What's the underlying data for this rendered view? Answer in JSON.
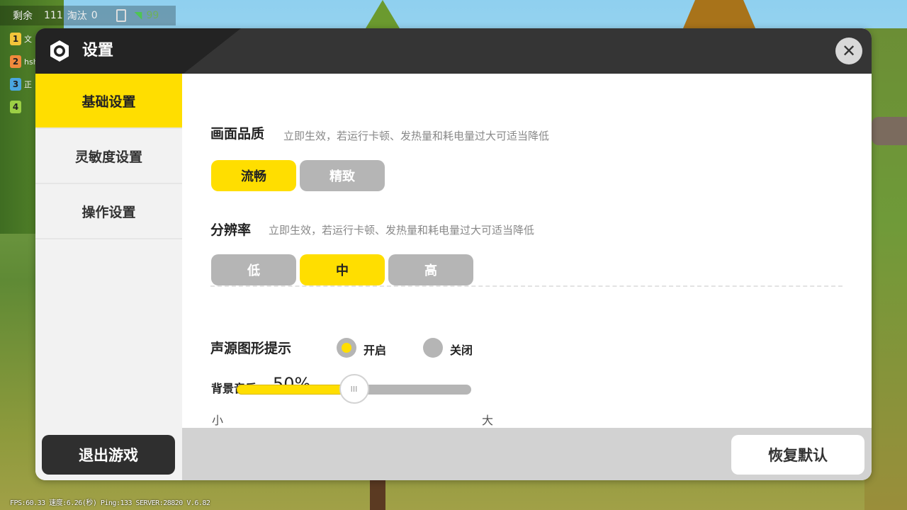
{
  "hud": {
    "remaining_label": "剩余",
    "remaining_count": "111",
    "eliminated_label": "淘汰",
    "eliminated_count": "0",
    "signal": "99",
    "ranks": [
      {
        "num": "1",
        "name": "文",
        "color": "#f2c53a"
      },
      {
        "num": "2",
        "name": "hsh",
        "color": "#f08a3c"
      },
      {
        "num": "3",
        "name": "正",
        "color": "#4aa6e0"
      },
      {
        "num": "4",
        "name": "",
        "color": "#9ccf45"
      }
    ]
  },
  "debug_text": "FPS:60.33 速度:6.26(秒) Ping:133 SERVER:28820 V.6.82",
  "modal": {
    "title": "设置",
    "close_icon": "close-icon",
    "sidebar": {
      "items": [
        {
          "label": "基础设置",
          "active": true
        },
        {
          "label": "灵敏度设置",
          "active": false
        },
        {
          "label": "操作设置",
          "active": false
        }
      ],
      "exit_label": "退出游戏"
    },
    "quality": {
      "title": "画面品质",
      "desc": "立即生效，若运行卡顿、发热量和耗电量过大可适当降低",
      "options": [
        {
          "label": "流畅",
          "selected": true
        },
        {
          "label": "精致",
          "selected": false
        }
      ]
    },
    "resolution": {
      "title": "分辨率",
      "desc": "立即生效，若运行卡顿、发热量和耗电量过大可适当降低",
      "options": [
        {
          "label": "低",
          "selected": false
        },
        {
          "label": "中",
          "selected": true
        },
        {
          "label": "高",
          "selected": false
        }
      ]
    },
    "sound_hint": {
      "title": "声源图形提示",
      "on_label": "开启",
      "off_label": "关闭",
      "selected": "on"
    },
    "bgm": {
      "title": "背景音乐",
      "value_text": "50%",
      "value": 0.5,
      "min_label": "小",
      "max_label": "大",
      "knob_text": "III"
    },
    "restore_label": "恢复默认"
  },
  "colors": {
    "accent": "#ffde00",
    "header_dark": "#353535",
    "inactive_option": "#b5b5b5"
  }
}
